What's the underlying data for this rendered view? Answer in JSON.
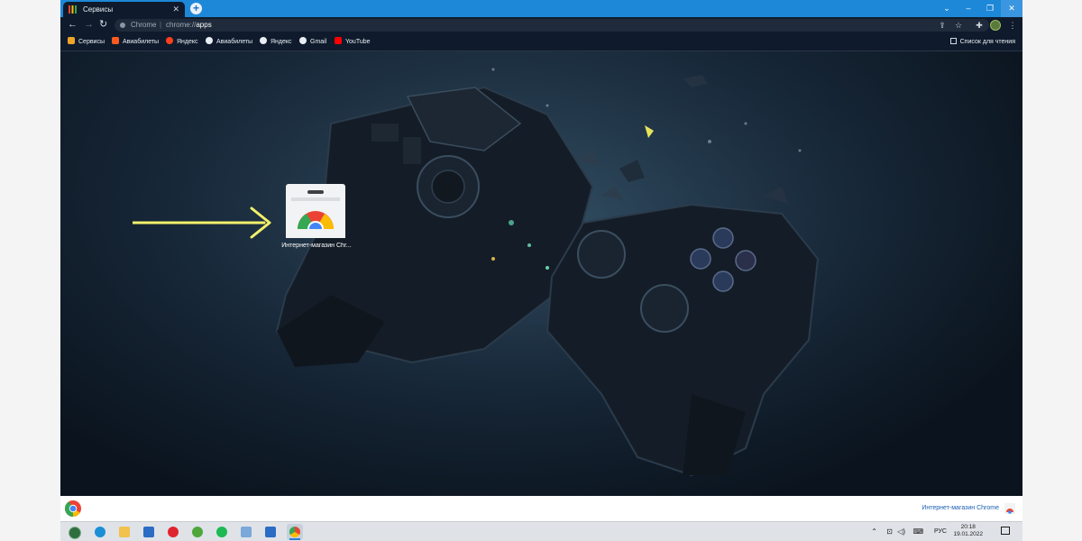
{
  "tab": {
    "title": "Сервисы"
  },
  "window_controls": {
    "search_tabs": "⌄",
    "minimize": "–",
    "restore": "❐",
    "close": "✕"
  },
  "toolbar": {
    "back": "←",
    "forward": "→",
    "reload": "↻",
    "scheme_label": "Chrome",
    "separator": "|",
    "url_prefix": "chrome://",
    "url_path": "apps"
  },
  "bookmarks": [
    {
      "label": "Сервисы",
      "icon": "apps-grid-icon",
      "color": "#f0a32a"
    },
    {
      "label": "Авиабилеты",
      "icon": "aviasales-icon",
      "color": "#ff5a1f"
    },
    {
      "label": "Яндекс",
      "icon": "yandex-icon",
      "color": "#fc3f1d"
    },
    {
      "label": "Авиабилеты",
      "icon": "globe-icon",
      "color": "#e8eef4"
    },
    {
      "label": "Яндекс",
      "icon": "globe-icon",
      "color": "#e8eef4"
    },
    {
      "label": "Gmail",
      "icon": "globe-icon",
      "color": "#e8eef4"
    },
    {
      "label": "YouTube",
      "icon": "youtube-icon",
      "color": "#ff0000"
    }
  ],
  "reading_list": {
    "label": "Список для чтения",
    "icon": "reading-list-icon"
  },
  "apps": [
    {
      "label": "Интернет-магазин Chr...",
      "icon": "chrome-web-store-icon"
    }
  ],
  "bottom_bar": {
    "store_link": "Интернет-магазин Chrome"
  },
  "taskbar": {
    "apps": [
      {
        "name": "start-orb",
        "color": "#2f6e3d"
      },
      {
        "name": "edge",
        "color": "#1b8fd6"
      },
      {
        "name": "file-explorer",
        "color": "#f2c14e"
      },
      {
        "name": "mail",
        "color": "#2b6cc4"
      },
      {
        "name": "opera",
        "color": "#e0242f"
      },
      {
        "name": "utorrent",
        "color": "#4fa63b"
      },
      {
        "name": "spotify",
        "color": "#1db954"
      },
      {
        "name": "paint",
        "color": "#7ba7d9"
      },
      {
        "name": "photos",
        "color": "#2b6cc4"
      },
      {
        "name": "chrome",
        "color": "#e8453c"
      }
    ],
    "tray": {
      "language": "РУС",
      "time": "20:18",
      "date": "19.01.2022"
    }
  },
  "colors": {
    "tabstrip": "#1e88d8",
    "chrome_dark": "#0f1b2c",
    "link": "#1a5fb4",
    "arrow": "#f3f06a"
  }
}
